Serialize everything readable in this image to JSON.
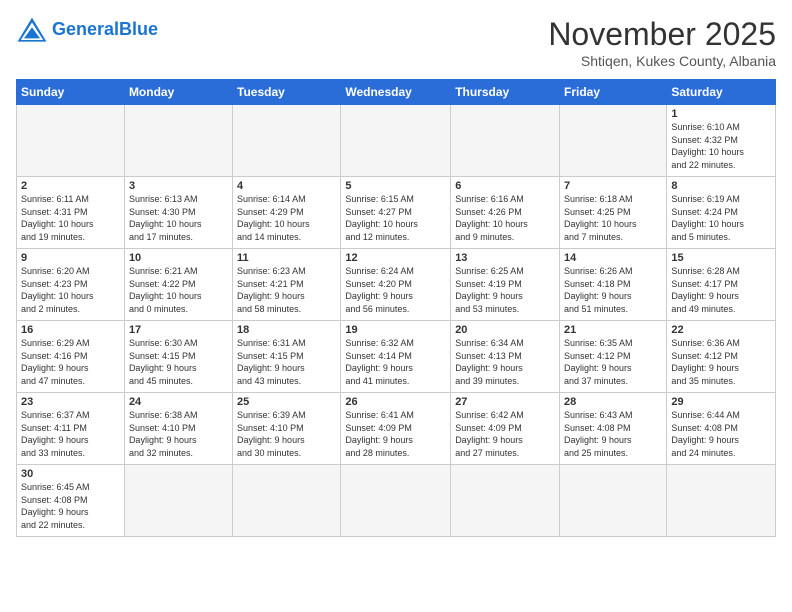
{
  "header": {
    "logo_general": "General",
    "logo_blue": "Blue",
    "title": "November 2025",
    "subtitle": "Shtiqen, Kukes County, Albania"
  },
  "weekdays": [
    "Sunday",
    "Monday",
    "Tuesday",
    "Wednesday",
    "Thursday",
    "Friday",
    "Saturday"
  ],
  "weeks": [
    [
      {
        "day": "",
        "info": "",
        "empty": true
      },
      {
        "day": "",
        "info": "",
        "empty": true
      },
      {
        "day": "",
        "info": "",
        "empty": true
      },
      {
        "day": "",
        "info": "",
        "empty": true
      },
      {
        "day": "",
        "info": "",
        "empty": true
      },
      {
        "day": "",
        "info": "",
        "empty": true
      },
      {
        "day": "1",
        "info": "Sunrise: 6:10 AM\nSunset: 4:32 PM\nDaylight: 10 hours\nand 22 minutes.",
        "empty": false
      }
    ],
    [
      {
        "day": "2",
        "info": "Sunrise: 6:11 AM\nSunset: 4:31 PM\nDaylight: 10 hours\nand 19 minutes.",
        "empty": false
      },
      {
        "day": "3",
        "info": "Sunrise: 6:13 AM\nSunset: 4:30 PM\nDaylight: 10 hours\nand 17 minutes.",
        "empty": false
      },
      {
        "day": "4",
        "info": "Sunrise: 6:14 AM\nSunset: 4:29 PM\nDaylight: 10 hours\nand 14 minutes.",
        "empty": false
      },
      {
        "day": "5",
        "info": "Sunrise: 6:15 AM\nSunset: 4:27 PM\nDaylight: 10 hours\nand 12 minutes.",
        "empty": false
      },
      {
        "day": "6",
        "info": "Sunrise: 6:16 AM\nSunset: 4:26 PM\nDaylight: 10 hours\nand 9 minutes.",
        "empty": false
      },
      {
        "day": "7",
        "info": "Sunrise: 6:18 AM\nSunset: 4:25 PM\nDaylight: 10 hours\nand 7 minutes.",
        "empty": false
      },
      {
        "day": "8",
        "info": "Sunrise: 6:19 AM\nSunset: 4:24 PM\nDaylight: 10 hours\nand 5 minutes.",
        "empty": false
      }
    ],
    [
      {
        "day": "9",
        "info": "Sunrise: 6:20 AM\nSunset: 4:23 PM\nDaylight: 10 hours\nand 2 minutes.",
        "empty": false
      },
      {
        "day": "10",
        "info": "Sunrise: 6:21 AM\nSunset: 4:22 PM\nDaylight: 10 hours\nand 0 minutes.",
        "empty": false
      },
      {
        "day": "11",
        "info": "Sunrise: 6:23 AM\nSunset: 4:21 PM\nDaylight: 9 hours\nand 58 minutes.",
        "empty": false
      },
      {
        "day": "12",
        "info": "Sunrise: 6:24 AM\nSunset: 4:20 PM\nDaylight: 9 hours\nand 56 minutes.",
        "empty": false
      },
      {
        "day": "13",
        "info": "Sunrise: 6:25 AM\nSunset: 4:19 PM\nDaylight: 9 hours\nand 53 minutes.",
        "empty": false
      },
      {
        "day": "14",
        "info": "Sunrise: 6:26 AM\nSunset: 4:18 PM\nDaylight: 9 hours\nand 51 minutes.",
        "empty": false
      },
      {
        "day": "15",
        "info": "Sunrise: 6:28 AM\nSunset: 4:17 PM\nDaylight: 9 hours\nand 49 minutes.",
        "empty": false
      }
    ],
    [
      {
        "day": "16",
        "info": "Sunrise: 6:29 AM\nSunset: 4:16 PM\nDaylight: 9 hours\nand 47 minutes.",
        "empty": false
      },
      {
        "day": "17",
        "info": "Sunrise: 6:30 AM\nSunset: 4:15 PM\nDaylight: 9 hours\nand 45 minutes.",
        "empty": false
      },
      {
        "day": "18",
        "info": "Sunrise: 6:31 AM\nSunset: 4:15 PM\nDaylight: 9 hours\nand 43 minutes.",
        "empty": false
      },
      {
        "day": "19",
        "info": "Sunrise: 6:32 AM\nSunset: 4:14 PM\nDaylight: 9 hours\nand 41 minutes.",
        "empty": false
      },
      {
        "day": "20",
        "info": "Sunrise: 6:34 AM\nSunset: 4:13 PM\nDaylight: 9 hours\nand 39 minutes.",
        "empty": false
      },
      {
        "day": "21",
        "info": "Sunrise: 6:35 AM\nSunset: 4:12 PM\nDaylight: 9 hours\nand 37 minutes.",
        "empty": false
      },
      {
        "day": "22",
        "info": "Sunrise: 6:36 AM\nSunset: 4:12 PM\nDaylight: 9 hours\nand 35 minutes.",
        "empty": false
      }
    ],
    [
      {
        "day": "23",
        "info": "Sunrise: 6:37 AM\nSunset: 4:11 PM\nDaylight: 9 hours\nand 33 minutes.",
        "empty": false
      },
      {
        "day": "24",
        "info": "Sunrise: 6:38 AM\nSunset: 4:10 PM\nDaylight: 9 hours\nand 32 minutes.",
        "empty": false
      },
      {
        "day": "25",
        "info": "Sunrise: 6:39 AM\nSunset: 4:10 PM\nDaylight: 9 hours\nand 30 minutes.",
        "empty": false
      },
      {
        "day": "26",
        "info": "Sunrise: 6:41 AM\nSunset: 4:09 PM\nDaylight: 9 hours\nand 28 minutes.",
        "empty": false
      },
      {
        "day": "27",
        "info": "Sunrise: 6:42 AM\nSunset: 4:09 PM\nDaylight: 9 hours\nand 27 minutes.",
        "empty": false
      },
      {
        "day": "28",
        "info": "Sunrise: 6:43 AM\nSunset: 4:08 PM\nDaylight: 9 hours\nand 25 minutes.",
        "empty": false
      },
      {
        "day": "29",
        "info": "Sunrise: 6:44 AM\nSunset: 4:08 PM\nDaylight: 9 hours\nand 24 minutes.",
        "empty": false
      }
    ],
    [
      {
        "day": "30",
        "info": "Sunrise: 6:45 AM\nSunset: 4:08 PM\nDaylight: 9 hours\nand 22 minutes.",
        "empty": false
      },
      {
        "day": "",
        "info": "",
        "empty": true
      },
      {
        "day": "",
        "info": "",
        "empty": true
      },
      {
        "day": "",
        "info": "",
        "empty": true
      },
      {
        "day": "",
        "info": "",
        "empty": true
      },
      {
        "day": "",
        "info": "",
        "empty": true
      },
      {
        "day": "",
        "info": "",
        "empty": true
      }
    ]
  ]
}
